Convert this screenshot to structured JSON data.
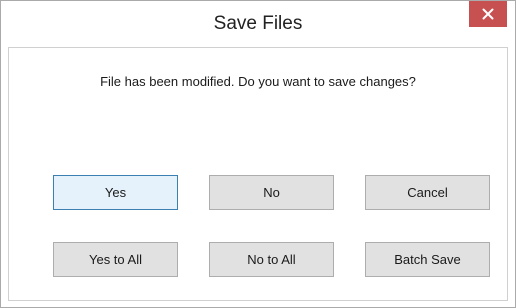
{
  "window": {
    "title": "Save Files",
    "close_icon": "close-icon"
  },
  "message": "File has been modified. Do you want to save changes?",
  "buttons": {
    "yes": "Yes",
    "no": "No",
    "cancel": "Cancel",
    "yes_to_all": "Yes to All",
    "no_to_all": "No to All",
    "batch_save": "Batch Save"
  },
  "colors": {
    "close_button": "#c75050",
    "default_button_border": "#3c7fb1",
    "default_button_bg": "#e5f1fb"
  }
}
